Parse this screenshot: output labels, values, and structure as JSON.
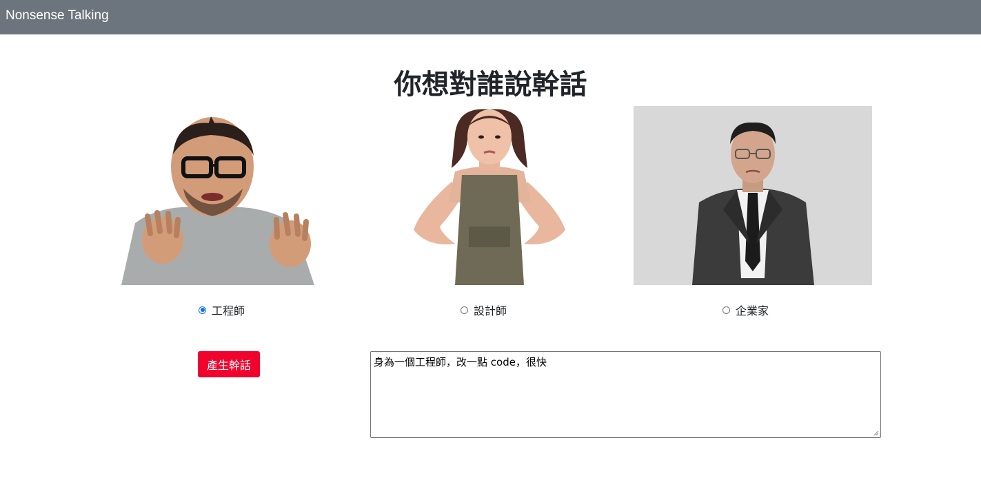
{
  "navbar": {
    "brand": "Nonsense Talking",
    "bg_color": "#6c757d"
  },
  "page": {
    "title": "你想對誰說幹話"
  },
  "targets": [
    {
      "label": "工程師",
      "checked": true,
      "icon": "engineer-photo"
    },
    {
      "label": "設計師",
      "checked": false,
      "icon": "designer-photo"
    },
    {
      "label": "企業家",
      "checked": false,
      "icon": "entrepreneur-photo"
    }
  ],
  "generate": {
    "label": "產生幹話",
    "color": "#f0042e"
  },
  "result": {
    "text": "身為一個工程師，改一點 code，很快"
  }
}
